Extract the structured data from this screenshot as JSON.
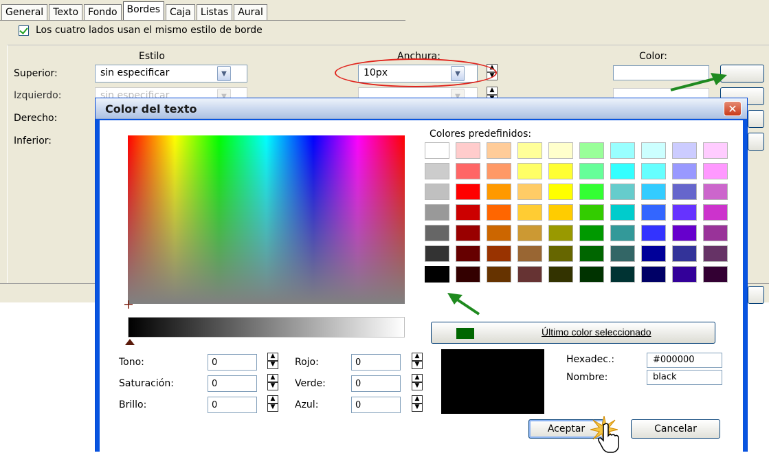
{
  "tabs": [
    "General",
    "Texto",
    "Fondo",
    "Bordes",
    "Caja",
    "Listas",
    "Aural"
  ],
  "active_tab": "Bordes",
  "same_style_checkbox": {
    "label": "Los cuatro lados usan el mismo estilo de borde",
    "checked": true
  },
  "columns": {
    "style": "Estilo",
    "width": "Anchura:",
    "color": "Color:"
  },
  "sides": {
    "top": {
      "label": "Superior:",
      "style_value": "sin especificar",
      "width_value": "10px"
    },
    "left": {
      "label": "Izquierdo:",
      "style_value": "sin especificar"
    },
    "right": {
      "label": "Derecho:"
    },
    "bottom": {
      "label": "Inferior:"
    }
  },
  "color_dialog": {
    "title": "Color del texto",
    "predefined_title": "Colores predefinidos:",
    "predefined_colors": [
      [
        "#ffffff",
        "#ffcccc",
        "#ffcc99",
        "#ffff99",
        "#ffffcc",
        "#99ff99",
        "#99ffff",
        "#ccffff",
        "#ccccff",
        "#ffccff"
      ],
      [
        "#cccccc",
        "#ff6666",
        "#ff9966",
        "#ffff66",
        "#ffff33",
        "#66ff99",
        "#33ffff",
        "#66ffff",
        "#9999ff",
        "#ff99ff"
      ],
      [
        "#c0c0c0",
        "#ff0000",
        "#ff9900",
        "#ffcc66",
        "#ffff00",
        "#33ff33",
        "#66cccc",
        "#33ccff",
        "#6666cc",
        "#cc66cc"
      ],
      [
        "#999999",
        "#cc0000",
        "#ff6600",
        "#ffcc33",
        "#ffcc00",
        "#33cc00",
        "#00cccc",
        "#3366ff",
        "#6633ff",
        "#cc33cc"
      ],
      [
        "#666666",
        "#990000",
        "#cc6600",
        "#cc9933",
        "#999900",
        "#009900",
        "#339999",
        "#3333ff",
        "#6600cc",
        "#993399"
      ],
      [
        "#333333",
        "#660000",
        "#993300",
        "#996633",
        "#666600",
        "#006600",
        "#336666",
        "#000099",
        "#333399",
        "#663366"
      ],
      [
        "#000000",
        "#330000",
        "#663300",
        "#663333",
        "#333300",
        "#003300",
        "#003333",
        "#000066",
        "#330099",
        "#330033"
      ]
    ],
    "selected_swatch": "#000000",
    "last_color_label": "Último color seleccionado",
    "last_color": "#006600",
    "hsb": {
      "hue_label": "Tono:",
      "hue": "0",
      "sat_label": "Saturación:",
      "sat": "0",
      "bri_label": "Brillo:",
      "bri": "0"
    },
    "rgb": {
      "red_label": "Rojo:",
      "red": "0",
      "green_label": "Verde:",
      "green": "0",
      "blue_label": "Azul:",
      "blue": "0"
    },
    "hex_label": "Hexadec.:",
    "hex_value": "#000000",
    "name_label": "Nombre:",
    "name_value": "black",
    "ok_label": "Aceptar",
    "cancel_label": "Cancelar"
  },
  "colors": {
    "dialog_frame": "#0854e0",
    "annotation_red": "#e0241d",
    "annotation_green": "#1f8a1f"
  }
}
